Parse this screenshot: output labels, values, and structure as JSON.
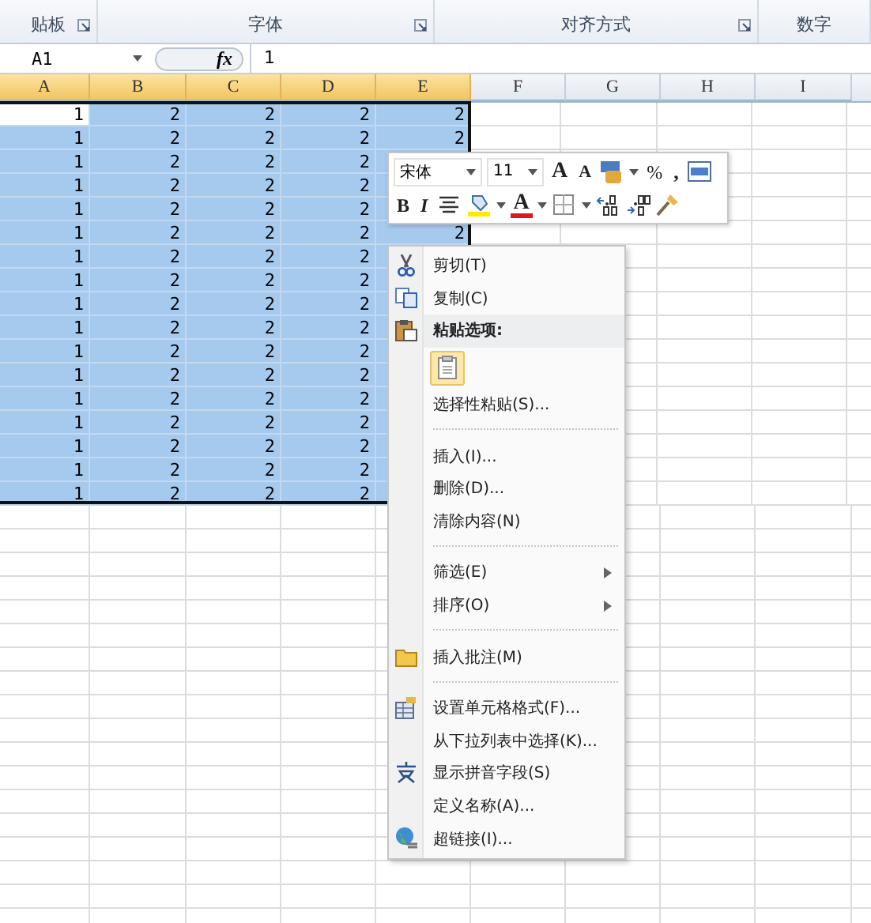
{
  "ribbon": {
    "groups": [
      {
        "label": "贴板",
        "launcher": true
      },
      {
        "label": "字体",
        "launcher": true
      },
      {
        "label": "对齐方式",
        "launcher": true
      },
      {
        "label": "数字",
        "launcher": false
      }
    ]
  },
  "formula_bar": {
    "name_box": "A1",
    "function_symbol": "fx",
    "value": "1"
  },
  "columns": [
    {
      "label": "A",
      "selected": true
    },
    {
      "label": "B",
      "selected": true
    },
    {
      "label": "C",
      "selected": true
    },
    {
      "label": "D",
      "selected": true
    },
    {
      "label": "E",
      "selected": true
    },
    {
      "label": "F",
      "selected": false
    },
    {
      "label": "G",
      "selected": false
    },
    {
      "label": "H",
      "selected": false
    },
    {
      "label": "I",
      "selected": false
    }
  ],
  "rows": [
    {
      "selected": true,
      "active": true,
      "cells": [
        "1",
        "2",
        "2",
        "2",
        "2"
      ]
    },
    {
      "selected": true,
      "active": false,
      "cells": [
        "1",
        "2",
        "2",
        "2",
        "2"
      ]
    },
    {
      "selected": true,
      "active": false,
      "cells": [
        "1",
        "2",
        "2",
        "2"
      ]
    },
    {
      "selected": true,
      "active": false,
      "cells": [
        "1",
        "2",
        "2",
        "2"
      ]
    },
    {
      "selected": true,
      "active": false,
      "cells": [
        "1",
        "2",
        "2",
        "2"
      ]
    },
    {
      "selected": true,
      "active": false,
      "cells": [
        "1",
        "2",
        "2",
        "2",
        "2"
      ]
    },
    {
      "selected": true,
      "active": false,
      "cells": [
        "1",
        "2",
        "2",
        "2"
      ]
    },
    {
      "selected": true,
      "active": false,
      "cells": [
        "1",
        "2",
        "2",
        "2"
      ]
    },
    {
      "selected": true,
      "active": false,
      "cells": [
        "1",
        "2",
        "2",
        "2"
      ]
    },
    {
      "selected": true,
      "active": false,
      "cells": [
        "1",
        "2",
        "2",
        "2"
      ]
    },
    {
      "selected": true,
      "active": false,
      "cells": [
        "1",
        "2",
        "2",
        "2"
      ]
    },
    {
      "selected": true,
      "active": false,
      "cells": [
        "1",
        "2",
        "2",
        "2"
      ]
    },
    {
      "selected": true,
      "active": false,
      "cells": [
        "1",
        "2",
        "2",
        "2"
      ]
    },
    {
      "selected": true,
      "active": false,
      "cells": [
        "1",
        "2",
        "2",
        "2"
      ]
    },
    {
      "selected": true,
      "active": false,
      "cells": [
        "1",
        "2",
        "2",
        "2"
      ]
    },
    {
      "selected": true,
      "active": false,
      "cells": [
        "1",
        "2",
        "2",
        "2"
      ]
    },
    {
      "selected": true,
      "active": false,
      "cells": [
        "1",
        "2",
        "2",
        "2"
      ]
    }
  ],
  "mini_toolbar": {
    "font_name": "宋体",
    "font_size": "11",
    "grow_font": "A",
    "shrink_font": "A",
    "percent": "%",
    "comma": ",",
    "bold": "B",
    "italic": "I",
    "font_color": "A"
  },
  "context_menu": [
    {
      "kind": "cut",
      "label": "剪切(T)"
    },
    {
      "kind": "copy",
      "label": "复制(C)"
    },
    {
      "kind": "paste-header",
      "label": "粘贴选项:"
    },
    {
      "kind": "paste-option"
    },
    {
      "kind": "command",
      "label": "选择性粘贴(S)..."
    },
    {
      "kind": "separator"
    },
    {
      "kind": "command",
      "label": "插入(I)..."
    },
    {
      "kind": "command",
      "label": "删除(D)..."
    },
    {
      "kind": "command",
      "label": "清除内容(N)"
    },
    {
      "kind": "separator"
    },
    {
      "kind": "submenu",
      "label": "筛选(E)"
    },
    {
      "kind": "submenu",
      "label": "排序(O)"
    },
    {
      "kind": "separator"
    },
    {
      "kind": "comment",
      "label": "插入批注(M)"
    },
    {
      "kind": "separator"
    },
    {
      "kind": "format",
      "label": "设置单元格格式(F)..."
    },
    {
      "kind": "command",
      "label": "从下拉列表中选择(K)..."
    },
    {
      "kind": "phonetic",
      "label": "显示拼音字段(S)"
    },
    {
      "kind": "command",
      "label": "定义名称(A)..."
    },
    {
      "kind": "hyperlink",
      "label": "超链接(I)..."
    }
  ]
}
